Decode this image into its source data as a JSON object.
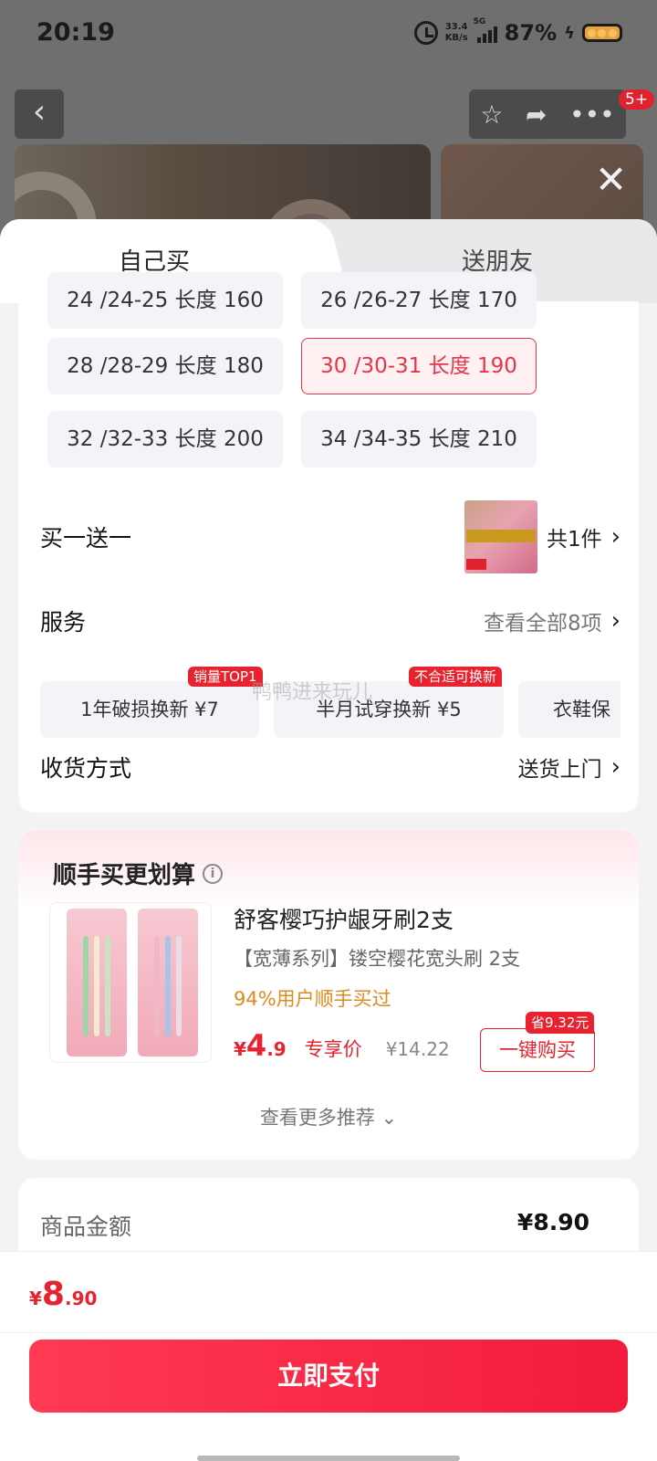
{
  "status_bar": {
    "time": "20:19",
    "net_speed_value": "33.4",
    "net_speed_unit": "KB/s",
    "network": "5G",
    "battery": "87%"
  },
  "nav": {
    "badge": "5+"
  },
  "tabs": {
    "self_buy": "自己买",
    "gift": "送朋友"
  },
  "sizes": [
    {
      "label": "24 /24-25 长度 160",
      "selected": false
    },
    {
      "label": "26 /26-27 长度 170",
      "selected": false
    },
    {
      "label": "28 /28-29 长度 180",
      "selected": false
    },
    {
      "label": "30 /30-31 长度 190",
      "selected": true
    },
    {
      "label": "32 /32-33 长度 200",
      "selected": false
    },
    {
      "label": "34 /34-35 长度 210",
      "selected": false
    }
  ],
  "promo": {
    "title": "买一送一",
    "count": "共1件"
  },
  "service": {
    "title": "服务",
    "view_all": "查看全部8项",
    "chips": [
      {
        "label": "1年破损换新  ¥7",
        "tag": "销量TOP1"
      },
      {
        "label": "半月试穿换新  ¥5",
        "tag": "不合适可换新"
      },
      {
        "label": "衣鞋保",
        "tag": ""
      }
    ],
    "watermark": "鸭鸭进来玩儿"
  },
  "delivery": {
    "title": "收货方式",
    "value": "送货上门"
  },
  "recommend": {
    "title": "顺手买更划算",
    "product_name": "舒客樱巧护龈牙刷2支",
    "product_sub": "【宽薄系列】镂空樱花宽头刷 2支",
    "buy_rate": "94%用户顺手买过",
    "price_symbol": "¥",
    "price_int": "4",
    "price_dec": ".9",
    "price_label": "专享价",
    "original_price": "¥14.22",
    "save_tag": "省9.32元",
    "buy_button": "一键购买",
    "more": "查看更多推荐 ⌄"
  },
  "amount": {
    "label": "商品金额",
    "value": "¥8.90"
  },
  "bottom": {
    "total_symbol": "¥",
    "total_int": "8",
    "total_dec": ".90",
    "pay_button": "立即支付"
  },
  "colors": {
    "accent": "#e8222f",
    "selected_border": "#e8334a",
    "pay_gradient_start": "#ff3a52",
    "buy_rate": "#e08a1e"
  }
}
